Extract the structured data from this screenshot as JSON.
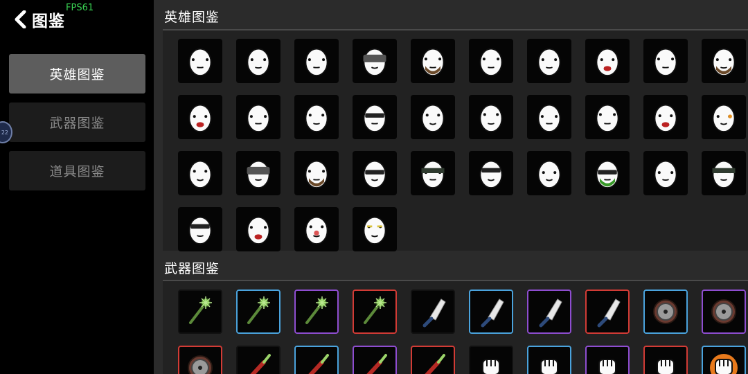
{
  "app": {
    "title": "图鉴",
    "fps": "FPS61"
  },
  "sidebar": {
    "items": [
      {
        "label": "英雄图鉴",
        "active": true
      },
      {
        "label": "武器图鉴",
        "active": false
      },
      {
        "label": "道具图鉴",
        "active": false
      }
    ],
    "float_ball_text": "22"
  },
  "heroes": {
    "title": "英雄图鉴",
    "items": [
      {
        "face": "grumpy"
      },
      {
        "face": "bruised"
      },
      {
        "face": "smirk"
      },
      {
        "face": "pirate"
      },
      {
        "face": "bearded"
      },
      {
        "face": "cute"
      },
      {
        "face": "mustache"
      },
      {
        "face": "bleeding"
      },
      {
        "face": "panda"
      },
      {
        "face": "stubble"
      },
      {
        "face": "shout"
      },
      {
        "face": "pale"
      },
      {
        "face": "sad"
      },
      {
        "face": "shades-pink"
      },
      {
        "face": "shocked"
      },
      {
        "face": "calm"
      },
      {
        "face": "smoker"
      },
      {
        "face": "whisker"
      },
      {
        "face": "scream"
      },
      {
        "face": "orange-eye"
      },
      {
        "face": "suit"
      },
      {
        "face": "helmet"
      },
      {
        "face": "hairy"
      },
      {
        "face": "masked-glasses"
      },
      {
        "face": "ninja"
      },
      {
        "face": "goggles"
      },
      {
        "face": "tophat"
      },
      {
        "face": "green-beard"
      },
      {
        "face": "blank"
      },
      {
        "face": "spiked"
      },
      {
        "face": "visor"
      },
      {
        "face": "angry"
      },
      {
        "face": "clown"
      },
      {
        "face": "sleepy"
      }
    ]
  },
  "weapons": {
    "title": "武器图鉴",
    "items": [
      {
        "type": "mace",
        "rarity": "black"
      },
      {
        "type": "mace",
        "rarity": "blue"
      },
      {
        "type": "mace",
        "rarity": "purple"
      },
      {
        "type": "mace",
        "rarity": "red"
      },
      {
        "type": "cleaver",
        "rarity": "black"
      },
      {
        "type": "cleaver",
        "rarity": "blue"
      },
      {
        "type": "cleaver",
        "rarity": "purple"
      },
      {
        "type": "cleaver",
        "rarity": "red"
      },
      {
        "type": "saw",
        "rarity": "blue"
      },
      {
        "type": "saw",
        "rarity": "purple"
      },
      {
        "type": "saw",
        "rarity": "red"
      },
      {
        "type": "dagger",
        "rarity": "black"
      },
      {
        "type": "dagger",
        "rarity": "blue"
      },
      {
        "type": "dagger",
        "rarity": "purple"
      },
      {
        "type": "dagger",
        "rarity": "red"
      },
      {
        "type": "fist",
        "rarity": "black"
      },
      {
        "type": "fist",
        "rarity": "blue"
      },
      {
        "type": "fist",
        "rarity": "purple"
      },
      {
        "type": "fist",
        "rarity": "red"
      },
      {
        "type": "fire-fist",
        "rarity": "blue"
      }
    ]
  },
  "colors": {
    "blue": "#4aa3dd",
    "purple": "#8e4dd0",
    "red": "#d23b35"
  }
}
